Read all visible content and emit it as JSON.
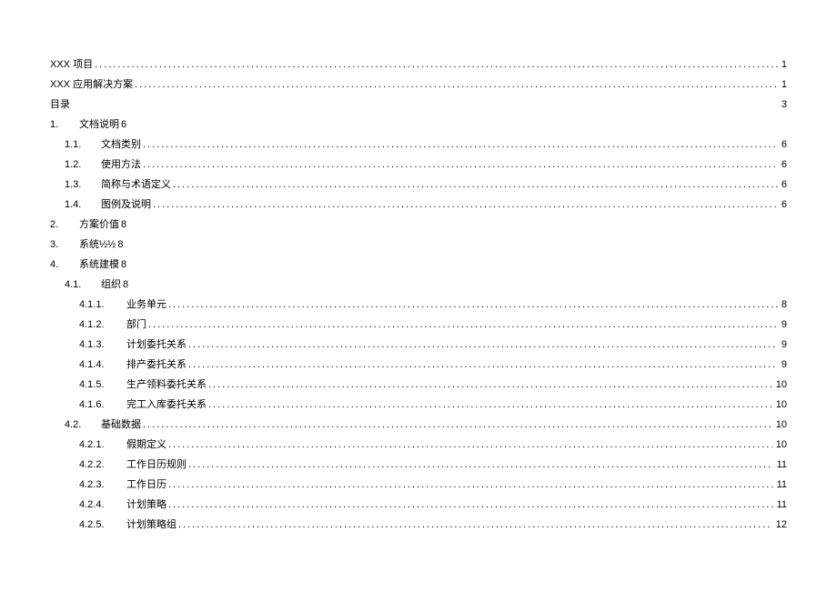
{
  "toc": [
    {
      "level": 0,
      "num": "",
      "title": "XXX 项目",
      "page": "1",
      "leader": true,
      "inline": false
    },
    {
      "level": 0,
      "num": "",
      "title": "XXX 应用解决方案",
      "page": "1",
      "leader": true,
      "inline": false
    },
    {
      "level": 0,
      "num": "",
      "title": "目录",
      "page": "3",
      "leader": false,
      "inline": false
    },
    {
      "level": 1,
      "num": "1.",
      "title": "文档说明",
      "page": "6",
      "leader": false,
      "inline": true
    },
    {
      "level": 2,
      "num": "1.1.",
      "title": "文档类别",
      "page": "6",
      "leader": true,
      "inline": false
    },
    {
      "level": 2,
      "num": "1.2.",
      "title": "使用方法",
      "page": "6",
      "leader": true,
      "inline": false
    },
    {
      "level": 2,
      "num": "1.3.",
      "title": "简称与术语定义",
      "page": "6",
      "leader": true,
      "inline": false
    },
    {
      "level": 2,
      "num": "1.4.",
      "title": "图例及说明",
      "page": "6",
      "leader": true,
      "inline": false
    },
    {
      "level": 1,
      "num": "2.",
      "title": "方案价值",
      "page": "8",
      "leader": false,
      "inline": true
    },
    {
      "level": 1,
      "num": "3.",
      "title": "系统½½",
      "page": "8",
      "leader": false,
      "inline": true
    },
    {
      "level": 1,
      "num": "4.",
      "title": "系统建模",
      "page": "8",
      "leader": false,
      "inline": true
    },
    {
      "level": 2,
      "num": "4.1.",
      "title": "组织",
      "page": "8",
      "leader": false,
      "inline": true
    },
    {
      "level": 3,
      "num": "4.1.1.",
      "title": "业务单元",
      "page": "8",
      "leader": true,
      "inline": false
    },
    {
      "level": 3,
      "num": "4.1.2.",
      "title": "部门",
      "page": "9",
      "leader": true,
      "inline": false
    },
    {
      "level": 3,
      "num": "4.1.3.",
      "title": "计划委托关系",
      "page": "9",
      "leader": true,
      "inline": false
    },
    {
      "level": 3,
      "num": "4.1.4.",
      "title": "排产委托关系",
      "page": "9",
      "leader": true,
      "inline": false
    },
    {
      "level": 3,
      "num": "4.1.5.",
      "title": "生产领料委托关系",
      "page": "10",
      "leader": true,
      "inline": false
    },
    {
      "level": 3,
      "num": "4.1.6.",
      "title": "完工入库委托关系",
      "page": "10",
      "leader": true,
      "inline": false
    },
    {
      "level": 2,
      "num": "4.2.",
      "title": "基础数据",
      "page": "10",
      "leader": true,
      "inline": false
    },
    {
      "level": 3,
      "num": "4.2.1.",
      "title": "假期定义",
      "page": "10",
      "leader": true,
      "inline": false
    },
    {
      "level": 3,
      "num": "4.2.2.",
      "title": "工作日历规则",
      "page": "11",
      "leader": true,
      "inline": false
    },
    {
      "level": 3,
      "num": "4.2.3.",
      "title": "工作日历",
      "page": "11",
      "leader": true,
      "inline": false
    },
    {
      "level": 3,
      "num": "4.2.4.",
      "title": "计划策略",
      "page": "11",
      "leader": true,
      "inline": false
    },
    {
      "level": 3,
      "num": "4.2.5.",
      "title": "计划策略组",
      "page": "12",
      "leader": true,
      "inline": false
    }
  ]
}
